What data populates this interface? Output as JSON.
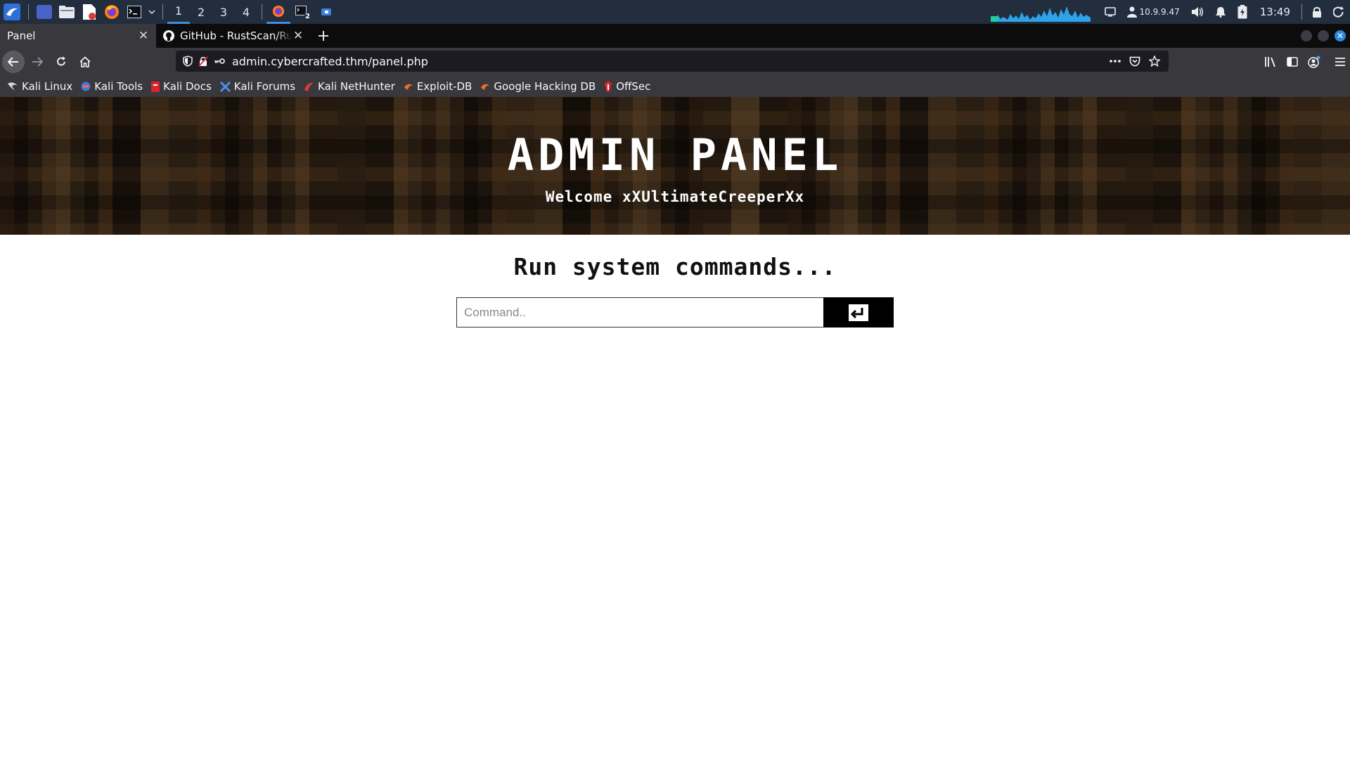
{
  "taskbar": {
    "workspaces": [
      "1",
      "2",
      "3",
      "4"
    ],
    "network_ip": "10.9.9.47",
    "clock": "13:49",
    "terminal_badge": "2",
    "colors": {
      "bg": "#222d3d",
      "accent": "#3f90dc",
      "graph": "#2fa3e8"
    }
  },
  "browser": {
    "tabs": [
      {
        "title": "Panel",
        "active": true
      },
      {
        "title": "GitHub - RustScan/RustS",
        "active": false
      }
    ],
    "url": "admin.cybercrafted.thm/panel.php",
    "bookmarks": [
      {
        "label": "Kali Linux",
        "icon": "kali-dragon-icon"
      },
      {
        "label": "Kali Tools",
        "icon": "kali-tools-icon"
      },
      {
        "label": "Kali Docs",
        "icon": "kali-docs-icon"
      },
      {
        "label": "Kali Forums",
        "icon": "kali-forums-icon"
      },
      {
        "label": "Kali NetHunter",
        "icon": "kali-nethunter-icon"
      },
      {
        "label": "Exploit-DB",
        "icon": "exploit-db-icon"
      },
      {
        "label": "Google Hacking DB",
        "icon": "ghdb-icon"
      },
      {
        "label": "OffSec",
        "icon": "offsec-icon"
      }
    ]
  },
  "page": {
    "title": "ADMIN PANEL",
    "welcome": "Welcome xXUltimateCreeperXx",
    "heading": "Run system commands...",
    "command_placeholder": "Command..",
    "submit_icon": "enter-arrow-icon"
  }
}
